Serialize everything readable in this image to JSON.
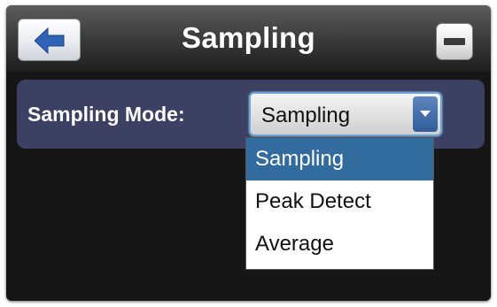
{
  "dialog": {
    "title": "Sampling",
    "back_icon": "back-arrow-icon",
    "minimize_icon": "minimize-icon"
  },
  "sampling_mode": {
    "label": "Sampling Mode:",
    "selected": "Sampling",
    "options": [
      "Sampling",
      "Peak Detect",
      "Average"
    ],
    "highlighted_index": 0
  },
  "colors": {
    "panel": "#3c4062",
    "highlight": "#326c9e",
    "background": "#161616"
  }
}
